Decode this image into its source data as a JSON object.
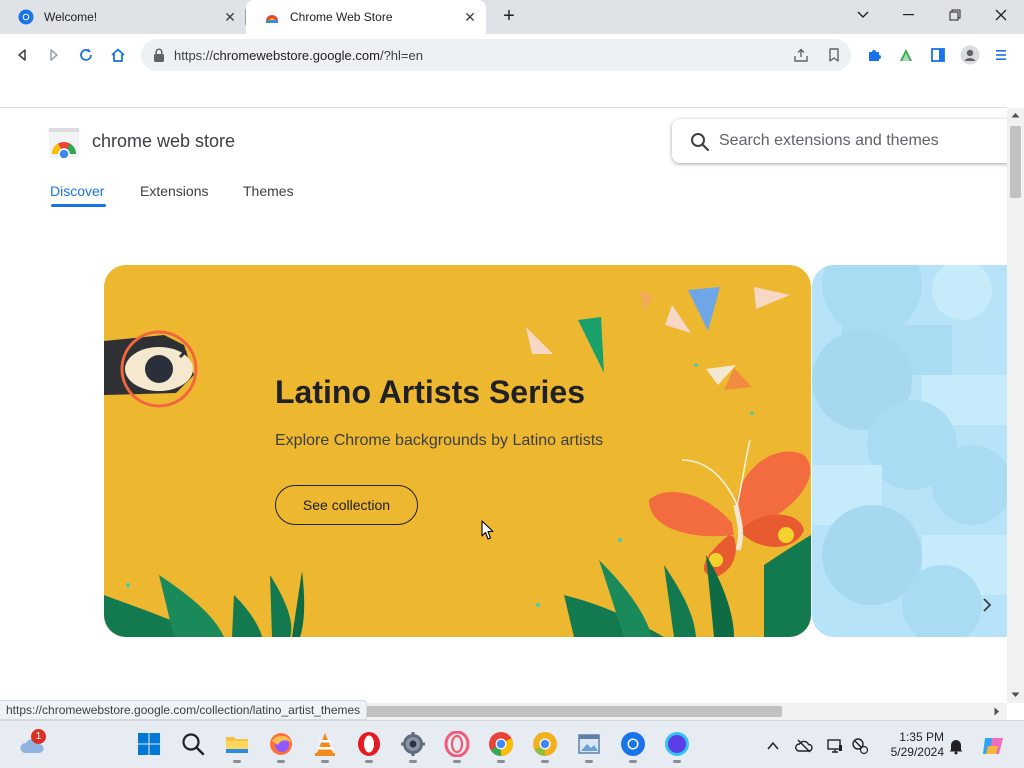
{
  "browser": {
    "tabs": [
      {
        "title": "Welcome!",
        "active": false
      },
      {
        "title": "Chrome Web Store",
        "active": true
      }
    ],
    "address": {
      "scheme": "https://",
      "host": "chromewebstore.google.com",
      "path": "/?hl=en"
    }
  },
  "store": {
    "brand": "chrome web store",
    "search_placeholder": "Search extensions and themes",
    "nav": [
      "Discover",
      "Extensions",
      "Themes"
    ],
    "active_nav": "Discover",
    "hero": {
      "title": "Latino Artists Series",
      "subtitle": "Explore Chrome backgrounds by Latino artists",
      "button": "See collection"
    }
  },
  "status_url": "https://chromewebstore.google.com/collection/latino_artist_themes",
  "taskbar": {
    "weather_badge": "1",
    "time": "1:35 PM",
    "date": "5/29/2024"
  },
  "colors": {
    "accent": "#1a73e8",
    "hero_background": "#edb72f",
    "next_card_background": "#b6e3f7"
  }
}
